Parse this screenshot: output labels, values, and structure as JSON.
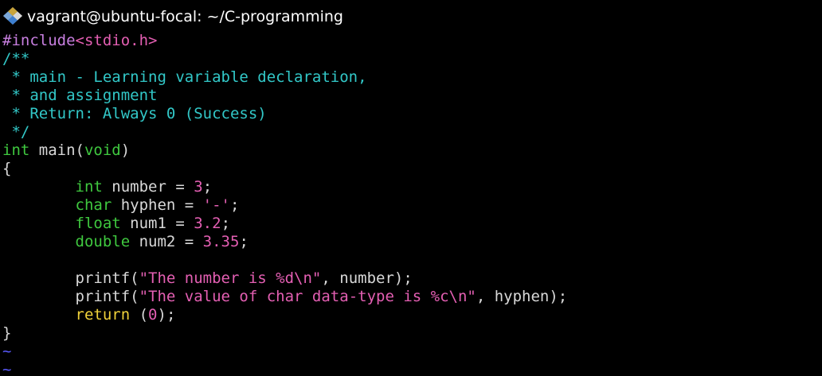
{
  "window": {
    "title": "vagrant@ubuntu-focal: ~/C-programming",
    "icon": "git-bash-diamond-icon"
  },
  "colors": {
    "background": "#000000",
    "preprocessor": "#c87fe0",
    "include_path": "#e45fb3",
    "comment": "#32c8c8",
    "type": "#3fc83f",
    "constant": "#e45fb3",
    "keyword": "#f0d23a",
    "text": "#d8d8d8",
    "tilde": "#5a5aff"
  },
  "editor": {
    "lines": [
      [
        {
          "c": "preproc",
          "t": "#include"
        },
        {
          "c": "incl",
          "t": "<stdio.h>"
        }
      ],
      [
        {
          "c": "comment",
          "t": "/**"
        }
      ],
      [
        {
          "c": "comment",
          "t": " * main - Learning variable declaration,"
        }
      ],
      [
        {
          "c": "comment",
          "t": " * and assignment"
        }
      ],
      [
        {
          "c": "comment",
          "t": " * Return: Always 0 (Success)"
        }
      ],
      [
        {
          "c": "comment",
          "t": " */"
        }
      ],
      [
        {
          "c": "type",
          "t": "int"
        },
        {
          "c": "plain",
          "t": " main("
        },
        {
          "c": "type",
          "t": "void"
        },
        {
          "c": "plain",
          "t": ")"
        }
      ],
      [
        {
          "c": "plain",
          "t": "{"
        }
      ],
      [
        {
          "c": "plain",
          "t": "        "
        },
        {
          "c": "type",
          "t": "int"
        },
        {
          "c": "plain",
          "t": " number = "
        },
        {
          "c": "num",
          "t": "3"
        },
        {
          "c": "plain",
          "t": ";"
        }
      ],
      [
        {
          "c": "plain",
          "t": "        "
        },
        {
          "c": "type",
          "t": "char"
        },
        {
          "c": "plain",
          "t": " hyphen = "
        },
        {
          "c": "str",
          "t": "'-'"
        },
        {
          "c": "plain",
          "t": ";"
        }
      ],
      [
        {
          "c": "plain",
          "t": "        "
        },
        {
          "c": "type",
          "t": "float"
        },
        {
          "c": "plain",
          "t": " num1 = "
        },
        {
          "c": "num",
          "t": "3.2"
        },
        {
          "c": "plain",
          "t": ";"
        }
      ],
      [
        {
          "c": "plain",
          "t": "        "
        },
        {
          "c": "type",
          "t": "double"
        },
        {
          "c": "plain",
          "t": " num2 = "
        },
        {
          "c": "num",
          "t": "3.35"
        },
        {
          "c": "plain",
          "t": ";"
        }
      ],
      [
        {
          "c": "plain",
          "t": ""
        }
      ],
      [
        {
          "c": "plain",
          "t": "        printf("
        },
        {
          "c": "str",
          "t": "\"The number is %d\\n\""
        },
        {
          "c": "plain",
          "t": ", number);"
        }
      ],
      [
        {
          "c": "plain",
          "t": "        printf("
        },
        {
          "c": "str",
          "t": "\"The value of char data-type is %c\\n\""
        },
        {
          "c": "plain",
          "t": ", hyphen);"
        }
      ],
      [
        {
          "c": "plain",
          "t": "        "
        },
        {
          "c": "kw",
          "t": "return"
        },
        {
          "c": "plain",
          "t": " ("
        },
        {
          "c": "num",
          "t": "0"
        },
        {
          "c": "plain",
          "t": ");"
        }
      ],
      [
        {
          "c": "plain",
          "t": "}"
        }
      ],
      [
        {
          "c": "tilde",
          "t": "~"
        }
      ],
      [
        {
          "c": "tilde",
          "t": "~"
        }
      ]
    ]
  }
}
